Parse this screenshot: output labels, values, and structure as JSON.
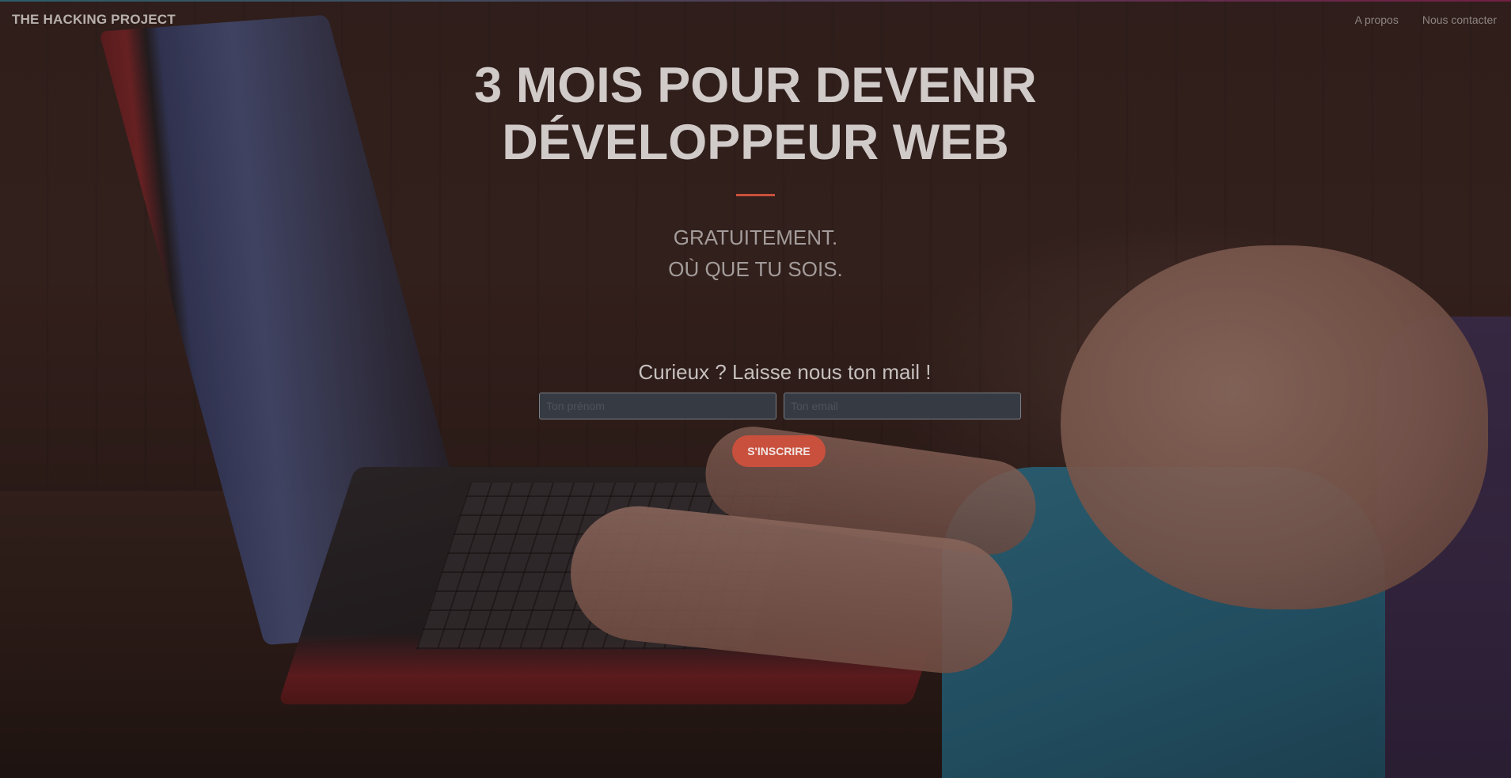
{
  "navbar": {
    "brand": "THE HACKING PROJECT",
    "links": [
      "A propos",
      "Nous contacter"
    ]
  },
  "hero": {
    "title_line1": "3 MOIS POUR DEVENIR",
    "title_line2": "DÉVELOPPEUR WEB",
    "subtitle_line1": "GRATUITEMENT.",
    "subtitle_line2": "OÙ QUE TU SOIS.",
    "cta_text": "Curieux ? Laisse nous ton mail !"
  },
  "form": {
    "first_name_placeholder": "Ton prénom",
    "email_placeholder": "Ton email",
    "submit_label": "S'INSCRIRE"
  },
  "colors": {
    "accent": "#c9503d",
    "overlay": "#231614"
  }
}
